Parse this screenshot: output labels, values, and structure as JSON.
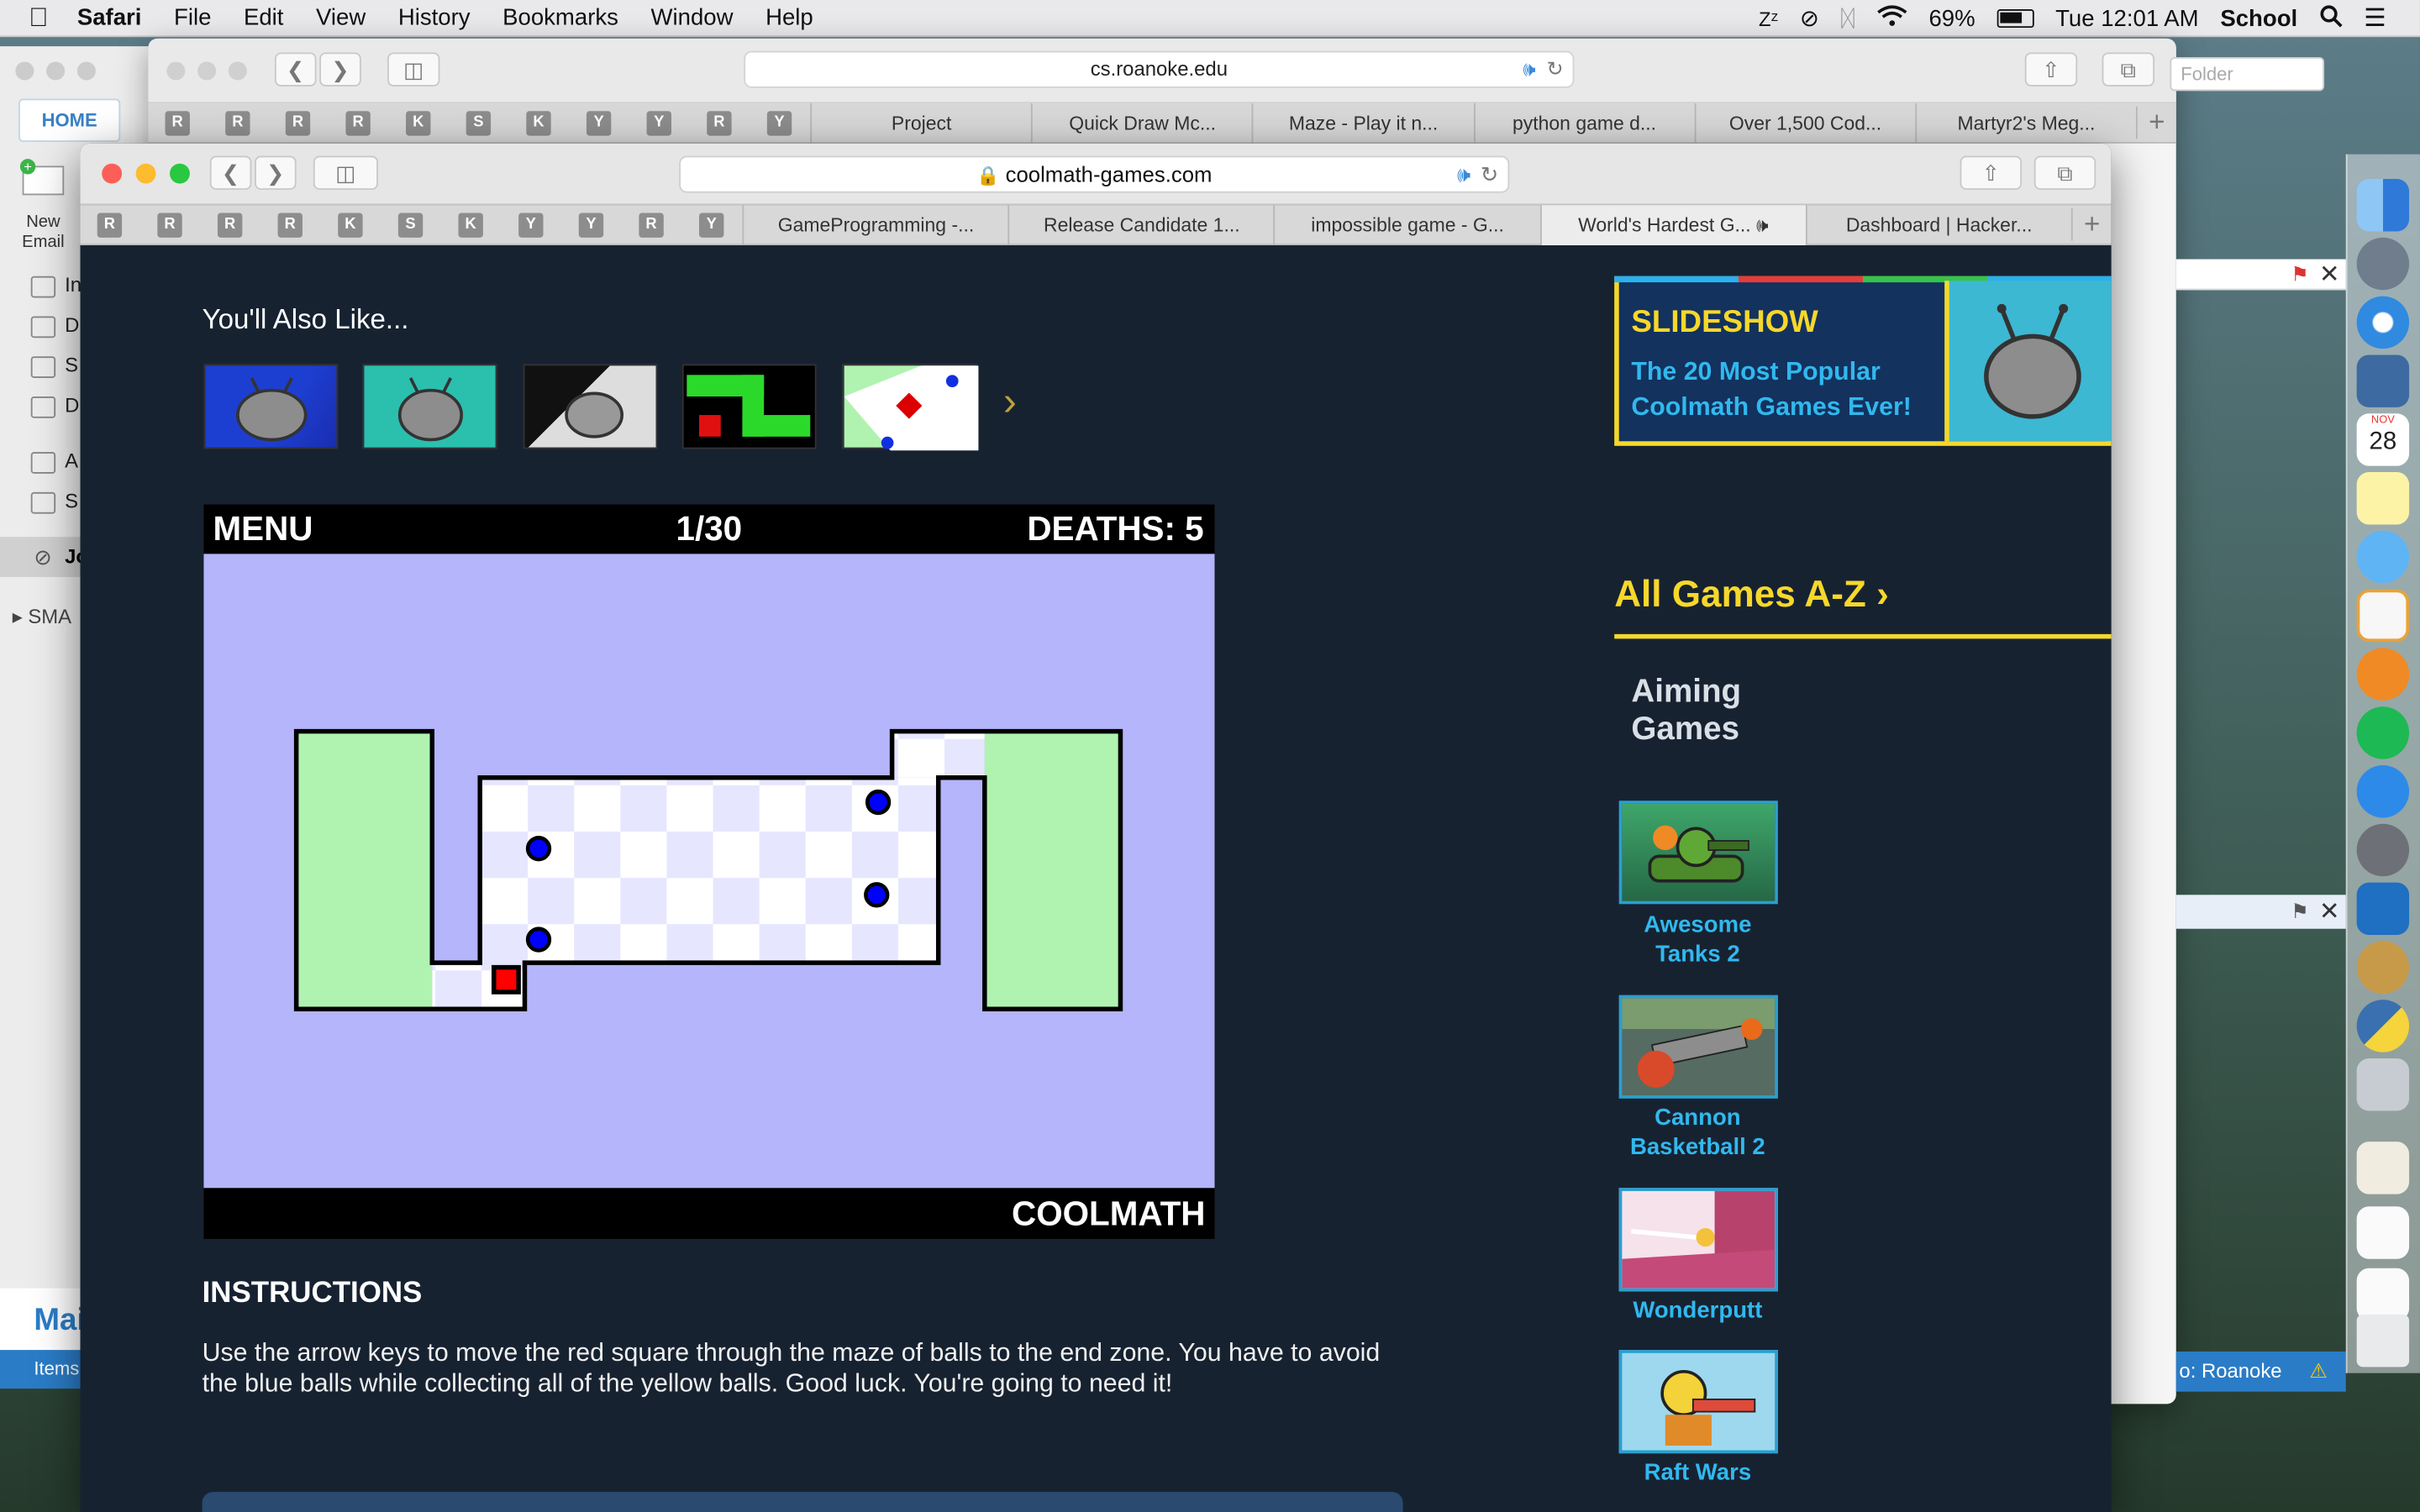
{
  "menubar": {
    "app": "Safari",
    "items": [
      "File",
      "Edit",
      "View",
      "History",
      "Bookmarks",
      "Window",
      "Help"
    ],
    "battery": "69%",
    "clock": "Tue 12:01 AM",
    "user": "School"
  },
  "back_window": {
    "url": "cs.roanoke.edu",
    "favicons": [
      "R",
      "R",
      "R",
      "R",
      "K",
      "S",
      "K",
      "Y",
      "Y",
      "R",
      "Y"
    ],
    "tabs": [
      "Project",
      "Quick Draw Mc...",
      "Maze - Play it n...",
      "python game d...",
      "Over 1,500 Cod...",
      "Martyr2's Meg..."
    ],
    "search_placeholder": "Folder"
  },
  "mail": {
    "home": "HOME",
    "new_email": "New Email",
    "sidebar_letters": [
      "In",
      "D",
      "S",
      "D",
      "A",
      "S",
      "Jo",
      "SMA"
    ],
    "footer_title": "Mai",
    "footer_status": "Items",
    "right_status": "o: Roanoke"
  },
  "front_window": {
    "url": "coolmath-games.com",
    "favicons": [
      "R",
      "R",
      "R",
      "R",
      "K",
      "S",
      "K",
      "Y",
      "Y",
      "R",
      "Y"
    ],
    "tabs": [
      "GameProgramming -...",
      "Release Candidate 1...",
      "impossible game - G...",
      "World's Hardest G...",
      "Dashboard | Hacker..."
    ],
    "active_tab": 3
  },
  "page": {
    "also_like": "You'll Also Like...",
    "game_hud": {
      "menu": "MENU",
      "level": "1/30",
      "deaths": "DEATHS: 5"
    },
    "game_footer": "COOLMATH",
    "instructions_title": "INSTRUCTIONS",
    "instructions_text": "Use the arrow keys to move the red square through the maze of balls to the end zone. You have to avoid the blue balls while collecting all of the yellow balls. Good luck. You're going to need it!",
    "slideshow": {
      "label": "SLIDESHOW",
      "text": "The 20 Most Popular Coolmath Games Ever!"
    },
    "all_games": "All Games A-Z",
    "category": "Aiming Games",
    "games": [
      "Awesome Tanks 2",
      "Cannon Basketball 2",
      "Wonderputt",
      "Raft Wars"
    ],
    "colors": {
      "bg": "#172231",
      "accent_yellow": "#f6d82b",
      "link_blue": "#31b8ee",
      "maze_bg": "#b4b5fa",
      "zone_green": "#b0f3b0",
      "player_red": "#ff0000",
      "ball_blue": "#0000ff"
    }
  },
  "dock": {
    "calendar_day": "28",
    "calendar_month": "NOV"
  }
}
